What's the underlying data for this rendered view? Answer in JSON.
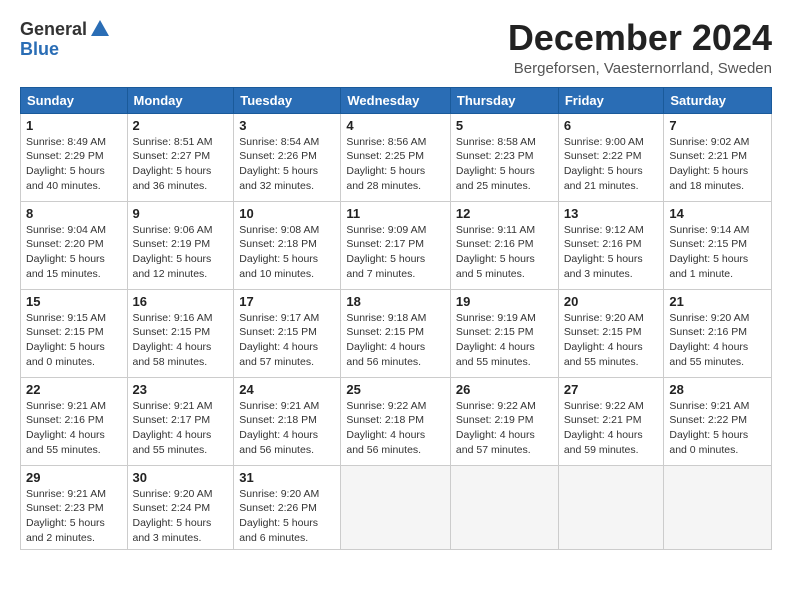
{
  "logo": {
    "general": "General",
    "blue": "Blue"
  },
  "title": "December 2024",
  "location": "Bergeforsen, Vaesternorrland, Sweden",
  "days_of_week": [
    "Sunday",
    "Monday",
    "Tuesday",
    "Wednesday",
    "Thursday",
    "Friday",
    "Saturday"
  ],
  "weeks": [
    [
      {
        "day": "1",
        "sunrise": "8:49 AM",
        "sunset": "2:29 PM",
        "daylight": "5 hours and 40 minutes."
      },
      {
        "day": "2",
        "sunrise": "8:51 AM",
        "sunset": "2:27 PM",
        "daylight": "5 hours and 36 minutes."
      },
      {
        "day": "3",
        "sunrise": "8:54 AM",
        "sunset": "2:26 PM",
        "daylight": "5 hours and 32 minutes."
      },
      {
        "day": "4",
        "sunrise": "8:56 AM",
        "sunset": "2:25 PM",
        "daylight": "5 hours and 28 minutes."
      },
      {
        "day": "5",
        "sunrise": "8:58 AM",
        "sunset": "2:23 PM",
        "daylight": "5 hours and 25 minutes."
      },
      {
        "day": "6",
        "sunrise": "9:00 AM",
        "sunset": "2:22 PM",
        "daylight": "5 hours and 21 minutes."
      },
      {
        "day": "7",
        "sunrise": "9:02 AM",
        "sunset": "2:21 PM",
        "daylight": "5 hours and 18 minutes."
      }
    ],
    [
      {
        "day": "8",
        "sunrise": "9:04 AM",
        "sunset": "2:20 PM",
        "daylight": "5 hours and 15 minutes."
      },
      {
        "day": "9",
        "sunrise": "9:06 AM",
        "sunset": "2:19 PM",
        "daylight": "5 hours and 12 minutes."
      },
      {
        "day": "10",
        "sunrise": "9:08 AM",
        "sunset": "2:18 PM",
        "daylight": "5 hours and 10 minutes."
      },
      {
        "day": "11",
        "sunrise": "9:09 AM",
        "sunset": "2:17 PM",
        "daylight": "5 hours and 7 minutes."
      },
      {
        "day": "12",
        "sunrise": "9:11 AM",
        "sunset": "2:16 PM",
        "daylight": "5 hours and 5 minutes."
      },
      {
        "day": "13",
        "sunrise": "9:12 AM",
        "sunset": "2:16 PM",
        "daylight": "5 hours and 3 minutes."
      },
      {
        "day": "14",
        "sunrise": "9:14 AM",
        "sunset": "2:15 PM",
        "daylight": "5 hours and 1 minute."
      }
    ],
    [
      {
        "day": "15",
        "sunrise": "9:15 AM",
        "sunset": "2:15 PM",
        "daylight": "5 hours and 0 minutes."
      },
      {
        "day": "16",
        "sunrise": "9:16 AM",
        "sunset": "2:15 PM",
        "daylight": "4 hours and 58 minutes."
      },
      {
        "day": "17",
        "sunrise": "9:17 AM",
        "sunset": "2:15 PM",
        "daylight": "4 hours and 57 minutes."
      },
      {
        "day": "18",
        "sunrise": "9:18 AM",
        "sunset": "2:15 PM",
        "daylight": "4 hours and 56 minutes."
      },
      {
        "day": "19",
        "sunrise": "9:19 AM",
        "sunset": "2:15 PM",
        "daylight": "4 hours and 55 minutes."
      },
      {
        "day": "20",
        "sunrise": "9:20 AM",
        "sunset": "2:15 PM",
        "daylight": "4 hours and 55 minutes."
      },
      {
        "day": "21",
        "sunrise": "9:20 AM",
        "sunset": "2:16 PM",
        "daylight": "4 hours and 55 minutes."
      }
    ],
    [
      {
        "day": "22",
        "sunrise": "9:21 AM",
        "sunset": "2:16 PM",
        "daylight": "4 hours and 55 minutes."
      },
      {
        "day": "23",
        "sunrise": "9:21 AM",
        "sunset": "2:17 PM",
        "daylight": "4 hours and 55 minutes."
      },
      {
        "day": "24",
        "sunrise": "9:21 AM",
        "sunset": "2:18 PM",
        "daylight": "4 hours and 56 minutes."
      },
      {
        "day": "25",
        "sunrise": "9:22 AM",
        "sunset": "2:18 PM",
        "daylight": "4 hours and 56 minutes."
      },
      {
        "day": "26",
        "sunrise": "9:22 AM",
        "sunset": "2:19 PM",
        "daylight": "4 hours and 57 minutes."
      },
      {
        "day": "27",
        "sunrise": "9:22 AM",
        "sunset": "2:21 PM",
        "daylight": "4 hours and 59 minutes."
      },
      {
        "day": "28",
        "sunrise": "9:21 AM",
        "sunset": "2:22 PM",
        "daylight": "5 hours and 0 minutes."
      }
    ],
    [
      {
        "day": "29",
        "sunrise": "9:21 AM",
        "sunset": "2:23 PM",
        "daylight": "5 hours and 2 minutes."
      },
      {
        "day": "30",
        "sunrise": "9:20 AM",
        "sunset": "2:24 PM",
        "daylight": "5 hours and 3 minutes."
      },
      {
        "day": "31",
        "sunrise": "9:20 AM",
        "sunset": "2:26 PM",
        "daylight": "5 hours and 6 minutes."
      },
      null,
      null,
      null,
      null
    ]
  ]
}
